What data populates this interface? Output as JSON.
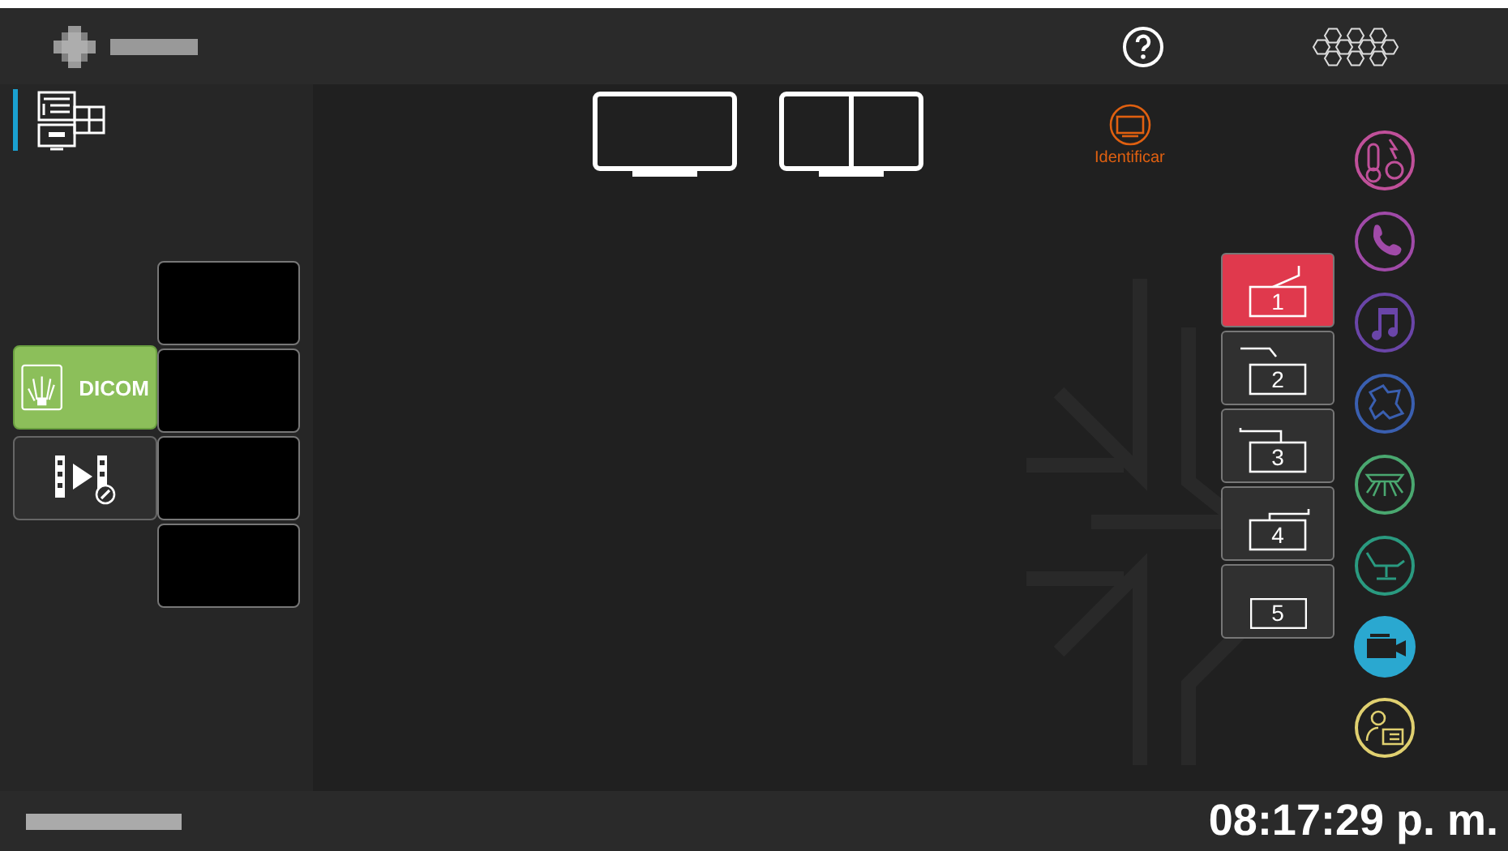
{
  "sidebar": {
    "layout_selected": true,
    "sources": [
      {
        "kind": "dicom",
        "label": "DICOM",
        "selected": true
      },
      {
        "kind": "video",
        "selected": false
      }
    ],
    "thumbnails": [
      {
        "kind": "empty"
      },
      {
        "kind": "empty"
      },
      {
        "kind": "empty"
      },
      {
        "kind": "empty"
      }
    ]
  },
  "layouts": [
    {
      "kind": "single",
      "selected": false
    },
    {
      "kind": "split",
      "selected": false
    }
  ],
  "identify": {
    "label": "Identificar"
  },
  "rooms": [
    {
      "label": "1",
      "kind": "up",
      "selected": true
    },
    {
      "label": "2",
      "kind": "down",
      "selected": false
    },
    {
      "label": "3",
      "kind": "left",
      "selected": false
    },
    {
      "label": "4",
      "kind": "right",
      "selected": false
    },
    {
      "label": "5",
      "kind": "none",
      "selected": false
    }
  ],
  "controls": [
    {
      "kind": "climate",
      "color": "#c0509a"
    },
    {
      "kind": "phone",
      "color": "#a04aa8"
    },
    {
      "kind": "music",
      "color": "#6a45a8"
    },
    {
      "kind": "blob",
      "color": "#3a5fb0"
    },
    {
      "kind": "lamp",
      "color": "#4aa870"
    },
    {
      "kind": "table",
      "color": "#2a9a80"
    },
    {
      "kind": "camera",
      "color": "#2aa8d0"
    },
    {
      "kind": "staff",
      "color": "#e0d070"
    }
  ],
  "clock": "08:17:29 p. m."
}
